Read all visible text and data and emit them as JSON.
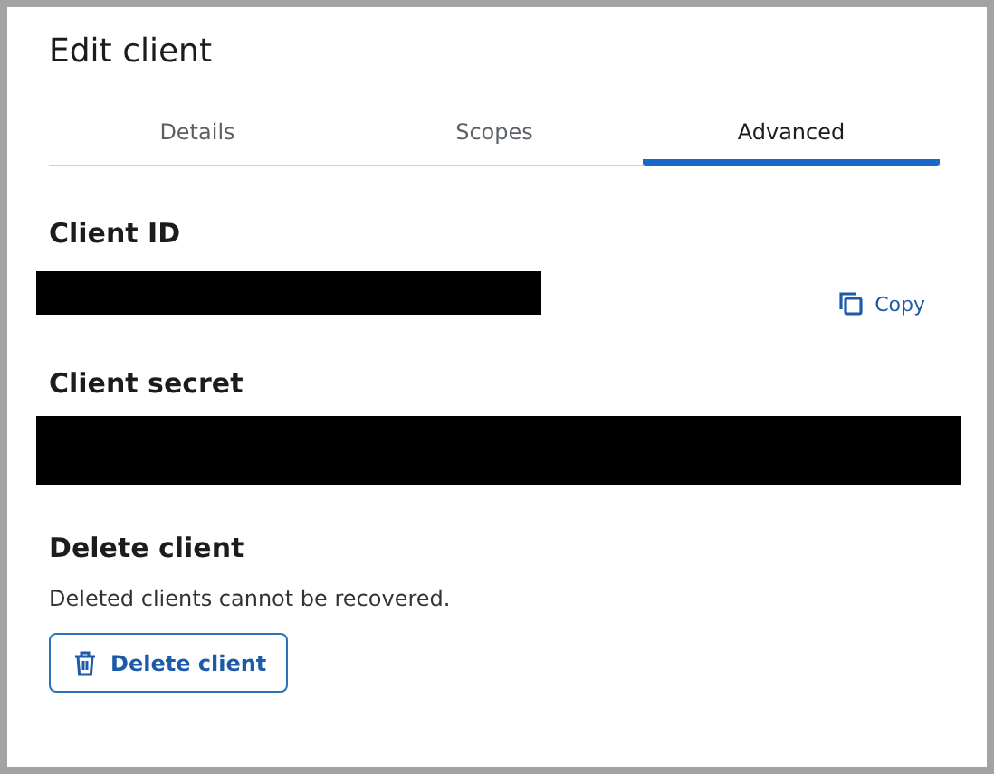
{
  "title": "Edit client",
  "tabs": [
    {
      "label": "Details",
      "selected": false
    },
    {
      "label": "Scopes",
      "selected": false
    },
    {
      "label": "Advanced",
      "selected": true
    }
  ],
  "client_id": {
    "label": "Client ID",
    "redacted": true,
    "copy_button": "Copy"
  },
  "client_secret": {
    "label": "Client secret",
    "redacted": true
  },
  "delete": {
    "heading": "Delete client",
    "description": "Deleted clients cannot be recovered.",
    "button": "Delete client"
  }
}
